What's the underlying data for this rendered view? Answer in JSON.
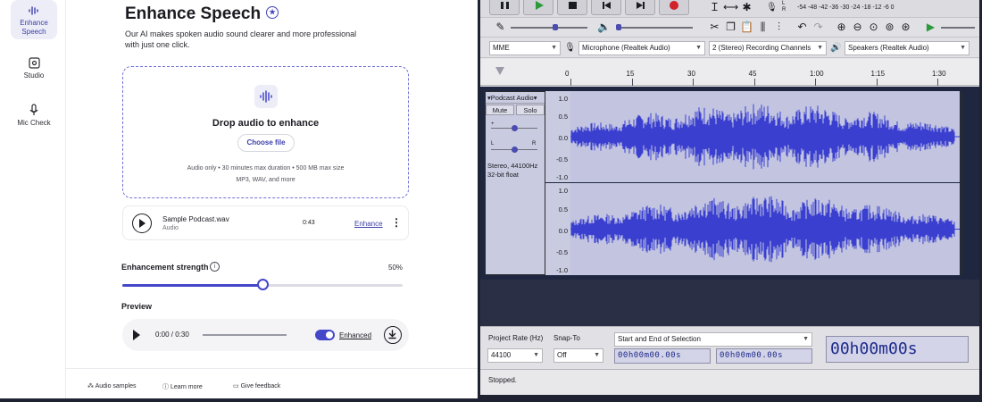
{
  "web": {
    "rail": {
      "items": [
        {
          "label": "Enhance Speech",
          "icon": "waveform-icon",
          "active": true
        },
        {
          "label": "Studio",
          "icon": "studio-icon",
          "active": false
        },
        {
          "label": "Mic Check",
          "icon": "microphone-icon",
          "active": false
        }
      ]
    },
    "title": "Enhance Speech",
    "subtitle": "Our AI makes spoken audio sound clearer and more professional with just one click.",
    "drop": {
      "title": "Drop audio to enhance",
      "button": "Choose file",
      "note1": "Audio only • 30 minutes max duration • 500 MB max size",
      "note2": "MP3, WAV, and more"
    },
    "file": {
      "name": "Sample Podcast.wav",
      "type": "Audio",
      "duration": "0:43",
      "action": "Enhance"
    },
    "strength": {
      "label": "Enhancement strength",
      "value_text": "50%",
      "value": 0.5
    },
    "preview": {
      "label": "Preview",
      "time": "0:00 / 0:30",
      "toggle_label": "Enhanced",
      "enabled": true
    },
    "footer": {
      "samples": "Audio samples",
      "learn": "Learn more",
      "feedback": "Give feedback"
    },
    "accent": "#4447c8"
  },
  "audacity": {
    "meter_scale": "-54  -48  -42  -36  -30  -24  -18  -12  -6  0",
    "host": "MME",
    "input_device": "Microphone (Realtek Audio)",
    "channels": "2 (Stereo) Recording Channels",
    "output_device": "Speakers (Realtek Audio)",
    "ruler": [
      "0",
      "15",
      "30",
      "45",
      "1:00",
      "1:15",
      "1:30"
    ],
    "track": {
      "name": "Podcast Audio",
      "mute": "Mute",
      "solo": "Solo",
      "info1": "Stereo, 44100Hz",
      "info2": "32-bit float",
      "scale": [
        "1.0",
        "0.5",
        "0.0",
        "-0.5",
        "-1.0"
      ]
    },
    "bottom": {
      "rate_label": "Project Rate (Hz)",
      "rate_value": "44100",
      "snap_label": "Snap-To",
      "snap_value": "Off",
      "selection_mode": "Start and End of Selection",
      "sel_start": "00h00m00.00s",
      "sel_end": "00h00m00.00s",
      "position": "00h00m00s"
    },
    "status": "Stopped.",
    "wave_color": "#3a3fd0"
  }
}
